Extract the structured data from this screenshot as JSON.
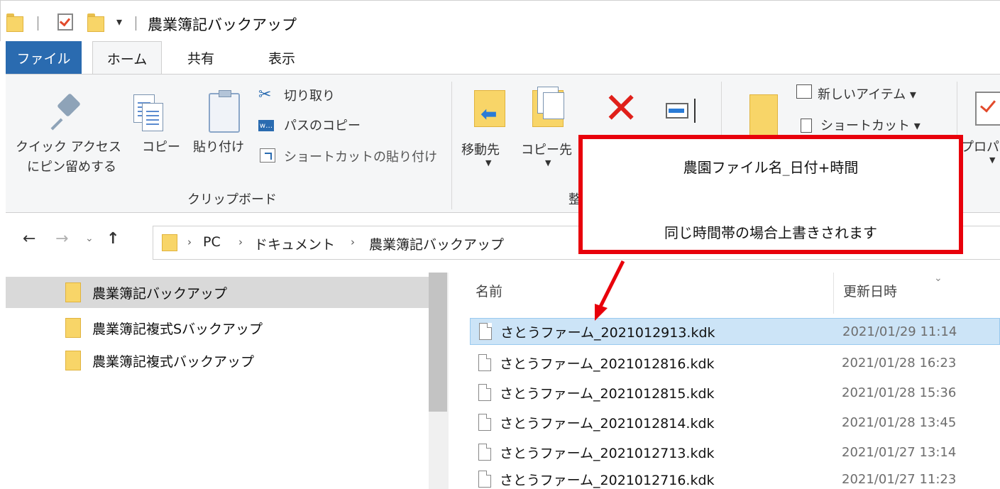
{
  "window": {
    "title": "農業簿記バックアップ",
    "qa_dropdown": "▾"
  },
  "tabs": [
    {
      "label": "ファイル"
    },
    {
      "label": "ホーム"
    },
    {
      "label": "共有"
    },
    {
      "label": "表示"
    }
  ],
  "ribbon": {
    "clipboard": {
      "pin_line1": "クイック アクセス",
      "pin_line2": "にピン留めする",
      "copy": "コピー",
      "paste": "貼り付け",
      "cut": "切り取り",
      "copy_path": "パスのコピー",
      "paste_shortcut": "ショートカットの貼り付け",
      "group_label": "クリップボード"
    },
    "organize": {
      "move_to": "移動先",
      "copy_to": "コピー先",
      "group_label_partial": "整"
    },
    "new": {
      "new_item": "新しいアイテム ▾",
      "shortcut": "ショートカット ▾"
    },
    "open": {
      "properties_partial": "プロパ"
    }
  },
  "nav": {
    "back": "←",
    "forward": "→",
    "recent": "⌄",
    "up": "↑",
    "path": [
      "PC",
      "ドキュメント",
      "農業簿記バックアップ"
    ],
    "chevron": "›"
  },
  "nav_pane": [
    {
      "label": "農業簿記バックアップ",
      "selected": true
    },
    {
      "label": "農業簿記複式Sバックアップ",
      "selected": false
    },
    {
      "label": "農業簿記複式バックアップ",
      "selected": false
    }
  ],
  "file_list": {
    "columns": {
      "name": "名前",
      "modified": "更新日時"
    },
    "sort_indicator": "⌄",
    "rows": [
      {
        "name": "さとうファーム_2021012913.kdk",
        "modified": "2021/01/29 11:14",
        "selected": true
      },
      {
        "name": "さとうファーム_2021012816.kdk",
        "modified": "2021/01/28 16:23",
        "selected": false
      },
      {
        "name": "さとうファーム_2021012815.kdk",
        "modified": "2021/01/28 15:36",
        "selected": false
      },
      {
        "name": "さとうファーム_2021012814.kdk",
        "modified": "2021/01/28 13:45",
        "selected": false
      },
      {
        "name": "さとうファーム_2021012713.kdk",
        "modified": "2021/01/27 13:14",
        "selected": false
      },
      {
        "name": "さとうファーム_2021012716.kdk",
        "modified": "2021/01/27 11:23",
        "selected": false
      }
    ]
  },
  "callout": {
    "line1": "農園ファイル名_日付+時間",
    "line2": "同じ時間帯の場合上書きされます"
  },
  "colors": {
    "accent": "#2a6bb0",
    "callout_border": "#e8000b",
    "selection": "#cce4f7"
  }
}
